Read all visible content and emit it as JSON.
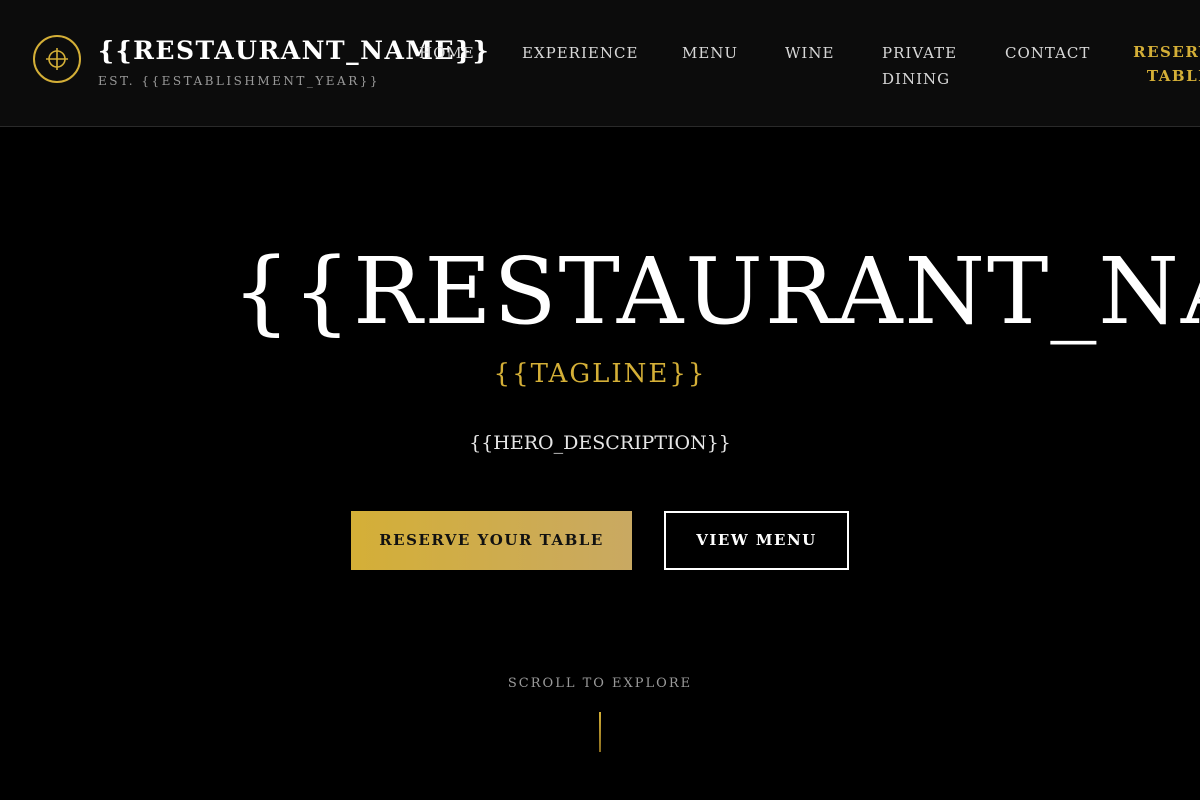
{
  "colors": {
    "accent": "#d4af37",
    "background": "#000000",
    "header_background": "#0c0c0c"
  },
  "header": {
    "logo_icon": "crosshair-circle-icon",
    "brand_name": "{{RESTAURANT_NAME}}",
    "established": "EST. {{ESTABLISHMENT_YEAR}}",
    "nav": {
      "home": "HOME",
      "experience": "EXPERIENCE",
      "menu": "MENU",
      "wine": "WINE",
      "private_dining_line1": "PRIVATE",
      "private_dining_line2": "DINING",
      "contact": "CONTACT"
    },
    "cta_line1": "RESERVE",
    "cta_line2": "TABLE"
  },
  "hero": {
    "title": "{{RESTAURANT_NAME}}",
    "tagline": "{{TAGLINE}}",
    "description": "{{HERO_DESCRIPTION}}",
    "primary_button": "RESERVE YOUR TABLE",
    "secondary_button": "VIEW MENU",
    "scroll_hint": "SCROLL TO EXPLORE"
  }
}
